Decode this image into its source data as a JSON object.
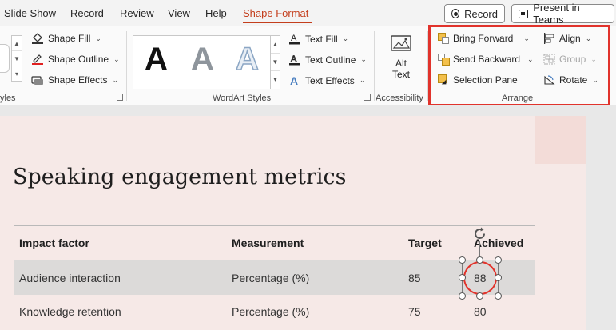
{
  "tabs": [
    {
      "label": "Slide Show",
      "active": false
    },
    {
      "label": "Record",
      "active": false
    },
    {
      "label": "Review",
      "active": false
    },
    {
      "label": "View",
      "active": false
    },
    {
      "label": "Help",
      "active": false
    },
    {
      "label": "Shape Format",
      "active": true
    }
  ],
  "top_buttons": {
    "record": "Record",
    "teams": "Present in Teams"
  },
  "ribbon": {
    "shape_styles": {
      "fill": "Shape Fill",
      "outline": "Shape Outline",
      "effects": "Shape Effects",
      "label": "yles"
    },
    "wordart": {
      "text_fill": "Text Fill",
      "text_outline": "Text Outline",
      "text_effects": "Text Effects",
      "label": "WordArt Styles",
      "sample_letter": "A"
    },
    "accessibility": {
      "alt_text_line1": "Alt",
      "alt_text_line2": "Text",
      "label": "Accessibility"
    },
    "arrange": {
      "bring_forward": "Bring Forward",
      "send_backward": "Send Backward",
      "selection_pane": "Selection Pane",
      "align": "Align",
      "group": "Group",
      "rotate": "Rotate",
      "label": "Arrange"
    }
  },
  "slide": {
    "title": "Speaking engagement metrics",
    "table": {
      "headers": [
        "Impact factor",
        "Measurement",
        "Target",
        "Achieved"
      ],
      "rows": [
        [
          "Audience interaction",
          "Percentage (%)",
          "85",
          "88"
        ],
        [
          "Knowledge retention",
          "Percentage (%)",
          "75",
          "80"
        ]
      ]
    }
  },
  "colors": {
    "accent": "#c43e1c",
    "highlight": "#e1332c"
  }
}
